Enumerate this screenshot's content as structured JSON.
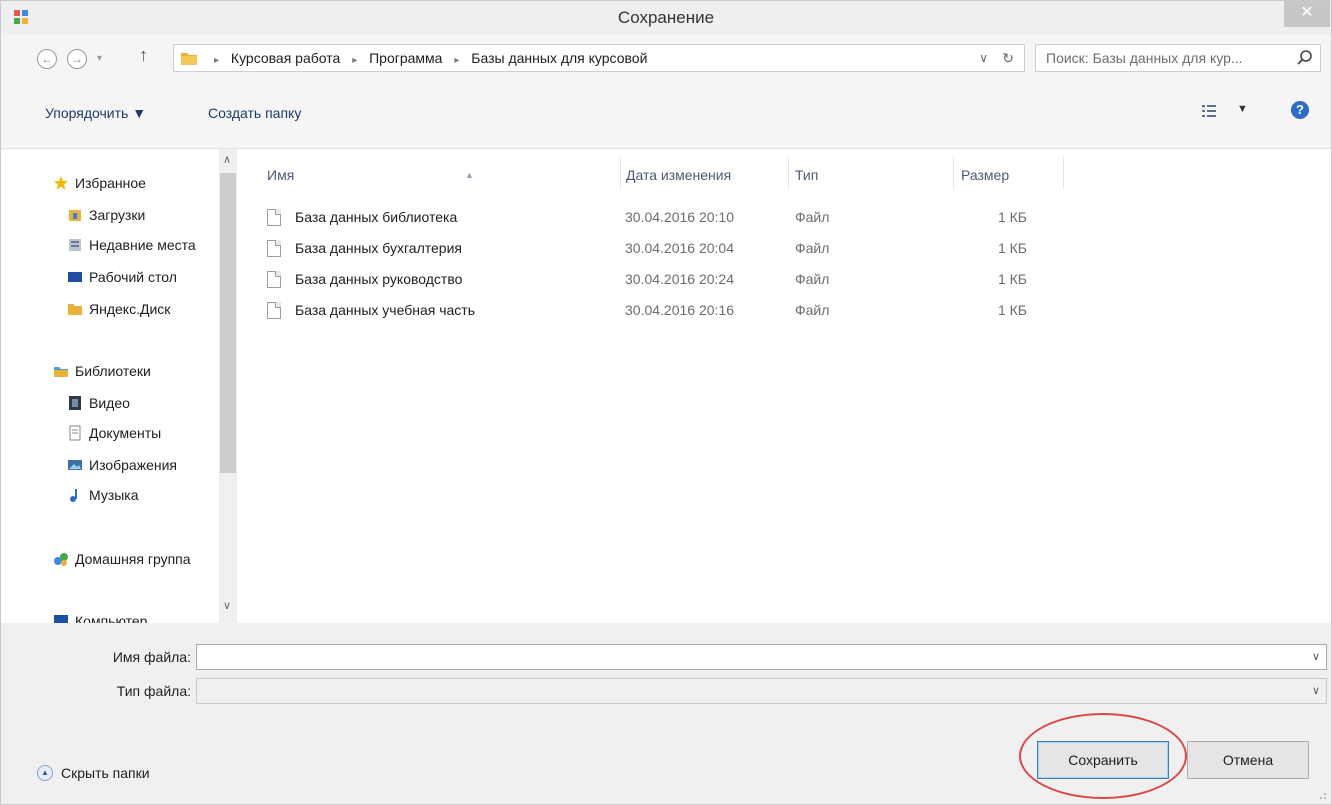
{
  "window": {
    "title": "Сохранение",
    "close_glyph": "✕"
  },
  "nav": {
    "back_glyph": "←",
    "forward_glyph": "→",
    "history_glyph": "▾",
    "up_glyph": "↑",
    "breadcrumbs": [
      "Курсовая работа",
      "Программа",
      "Базы данных для курсовой"
    ],
    "breadcrumb_sep": "▸",
    "address_drop_glyph": "∨",
    "refresh_glyph": "↻",
    "search_placeholder": "Поиск: Базы данных для кур..."
  },
  "toolbar": {
    "organize_label": "Упорядочить ▼",
    "new_folder_label": "Создать папку",
    "view_drop_glyph": "▼",
    "help_glyph": "?"
  },
  "tree": {
    "favorites": "Избранное",
    "downloads": "Загрузки",
    "recent": "Недавние места",
    "desktop": "Рабочий стол",
    "yandex": "Яндекс.Диск",
    "libraries": "Библиотеки",
    "video": "Видео",
    "documents": "Документы",
    "pictures": "Изображения",
    "music": "Музыка",
    "homegroup": "Домашняя группа",
    "computer": "Компьютер",
    "scroll_up": "∧",
    "scroll_down": "∨"
  },
  "columns": {
    "name": "Имя",
    "date": "Дата изменения",
    "type": "Тип",
    "size": "Размер",
    "sort_glyph": "▲"
  },
  "files": [
    {
      "name": "База данных библиотека",
      "date": "30.04.2016 20:10",
      "type": "Файл",
      "size": "1 КБ"
    },
    {
      "name": "База данных бухгалтерия",
      "date": "30.04.2016 20:04",
      "type": "Файл",
      "size": "1 КБ"
    },
    {
      "name": "База данных руководство",
      "date": "30.04.2016 20:24",
      "type": "Файл",
      "size": "1 КБ"
    },
    {
      "name": "База данных учебная часть",
      "date": "30.04.2016 20:16",
      "type": "Файл",
      "size": "1 КБ"
    }
  ],
  "form": {
    "filename_label": "Имя файла:",
    "filename_value": "",
    "filetype_label": "Тип файла:",
    "filetype_value": "",
    "drop_glyph": "∨"
  },
  "footer": {
    "hide_folders_label": "Скрыть папки",
    "hide_glyph": "▲",
    "save_label": "Сохранить",
    "cancel_label": "Отмена"
  },
  "colors": {
    "accent": "#2f6cc4",
    "annotation": "#d94848",
    "folder": "#e8b23a"
  }
}
